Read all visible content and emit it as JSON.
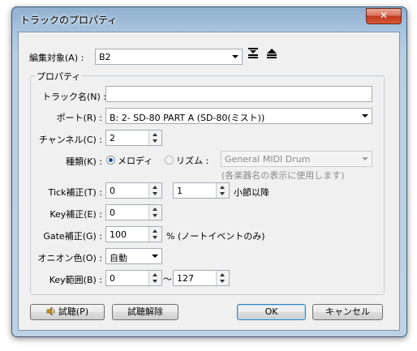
{
  "window": {
    "title": "トラックのプロパティ",
    "close_glyph": "✕"
  },
  "target": {
    "label": "編集対象(A) :",
    "value": "B2"
  },
  "props": {
    "group_title": "プロパティ",
    "track_name": {
      "label": "トラック名(N) :",
      "value": ""
    },
    "port": {
      "label": "ポート(R) :",
      "value": "B: 2- SD-80 PART A (SD-80(ミスト))"
    },
    "channel": {
      "label": "チャンネル(C) :",
      "value": "2"
    },
    "kind": {
      "label": "種類(K) :",
      "melody": "メロディ",
      "rhythm": "リズム :",
      "selected": "melody",
      "drum_set": "General MIDI Drum",
      "note": "(各楽器名の表示に使用します)"
    },
    "tick": {
      "label": "Tick補正(T) :",
      "value": "0",
      "bar": "1",
      "suffix": "小節以降"
    },
    "key": {
      "label": "Key補正(E) :",
      "value": "0"
    },
    "gate": {
      "label": "Gate補正(G) :",
      "value": "100",
      "suffix": "% (ノートイベントのみ)"
    },
    "onion": {
      "label": "オニオン色(O) :",
      "value": "自動"
    },
    "key_range": {
      "label": "Key範囲(B) :",
      "from": "0",
      "sep": "～",
      "to": "127"
    }
  },
  "buttons": {
    "audition": "試聴(P)",
    "audition_icon": "speaker-icon",
    "cancel_audition": "試聴解除",
    "ok": "OK",
    "cancel": "キャンセル"
  }
}
